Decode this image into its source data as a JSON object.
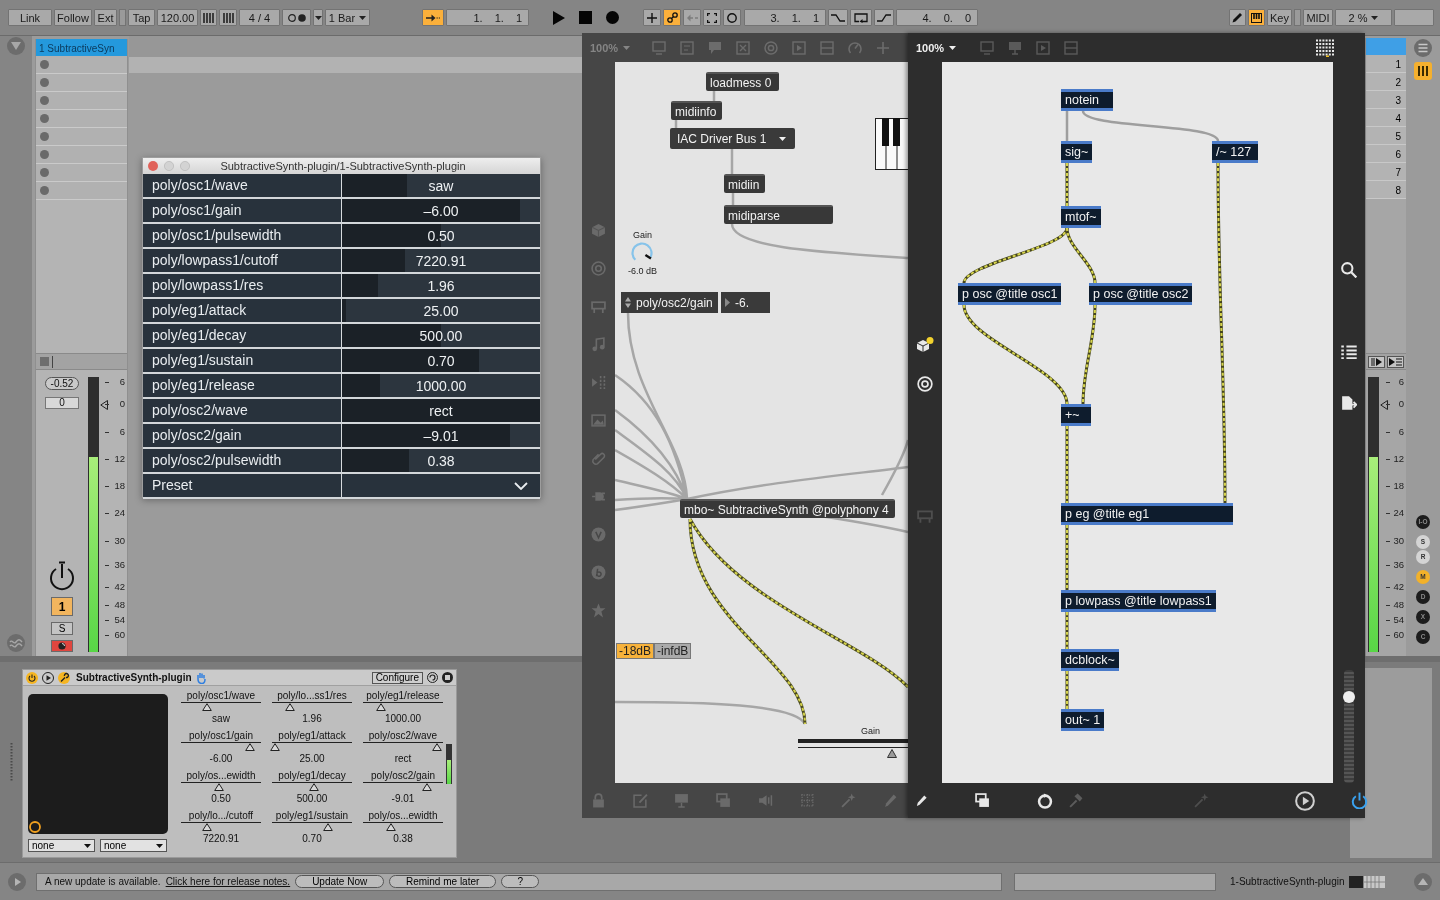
{
  "transport_bar": {
    "link": "Link",
    "follow": "Follow",
    "ext": "Ext",
    "tap": "Tap",
    "tempo": "120.00",
    "time_signature": "4 / 4",
    "metronome_on": false,
    "quantization": "1 Bar",
    "arrangement_follow_on": true,
    "song_position": "1. 1. 1",
    "arrangement_tools": [
      {
        "on": false,
        "disabled": false
      },
      {
        "on": true,
        "disabled": false
      },
      {
        "on": false,
        "disabled": true
      },
      {
        "on": false,
        "disabled": false
      },
      {
        "on": false,
        "disabled": false
      }
    ],
    "loop_start": "3. 1. 1",
    "punch_in_on": false,
    "loop_on": false,
    "punch_out_on": false,
    "loop_length": "4. 0. 0",
    "draw_mode_on": false,
    "keyboard_on": true,
    "key": "Key",
    "midi": "MIDI",
    "cpu_load": "2 %"
  },
  "track": {
    "name": "1 SubtractiveSyn",
    "peak": "-0.52",
    "volume": "0",
    "meter": {
      "level": 0.71
    },
    "fader": {
      "level": 0.9
    },
    "scale": [
      "6",
      "0",
      "6",
      "12",
      "18",
      "24",
      "30",
      "36",
      "42",
      "48",
      "54",
      "60"
    ],
    "number": "1",
    "active": true,
    "solo": "S",
    "solo_on": false,
    "armed": true
  },
  "scenes": [
    "1",
    "2",
    "3",
    "4",
    "5",
    "6",
    "7",
    "8"
  ],
  "master": {
    "view_toggle_on": true,
    "meter": {
      "level": 0.71
    },
    "fader": {
      "level": 0.9
    },
    "scale": [
      "6",
      "0",
      "6",
      "12",
      "18",
      "24",
      "30",
      "36",
      "42",
      "48",
      "54",
      "60"
    ],
    "section_toggles": [
      {
        "label": "I-O",
        "color": "#1c1c1c"
      },
      {
        "label": "S",
        "color": "#d4d4d4"
      },
      {
        "label": "R",
        "color": "#d4d4d4"
      },
      {
        "label": "M",
        "color": "#f2b12a"
      },
      {
        "label": "D",
        "color": "#1c1c1c"
      },
      {
        "label": "X",
        "color": "#1c1c1c"
      },
      {
        "label": "C",
        "color": "#1c1c1c"
      }
    ]
  },
  "device": {
    "on": true,
    "name": "SubtractiveSynth-plugin",
    "configure": "Configure",
    "parameters": [
      {
        "label": "poly/osc1/wave",
        "value": "saw",
        "level": 0.32
      },
      {
        "label": "poly/osc1/gain",
        "value": "-6.00",
        "level": 0.86
      },
      {
        "label": "poly/os...ewidth",
        "value": "0.50",
        "level": 0.48
      },
      {
        "label": "poly/lo.../cutoff",
        "value": "7220.91",
        "level": 0.32
      },
      {
        "label": "poly/lo...ss1/res",
        "value": "1.96",
        "level": 0.23
      },
      {
        "label": "poly/eg1/attack",
        "value": "25.00",
        "level": 0.04
      },
      {
        "label": "poly/eg1/decay",
        "value": "500.00",
        "level": 0.52
      },
      {
        "label": "poly/eg1/sustain",
        "value": "0.70",
        "level": 0.7
      },
      {
        "label": "poly/eg1/release",
        "value": "1000.00",
        "level": 0.23
      },
      {
        "label": "poly/osc2/wave",
        "value": "rect",
        "level": 0.93
      },
      {
        "label": "poly/osc2/gain",
        "value": "-9.01",
        "level": 0.8
      },
      {
        "label": "poly/os...ewidth",
        "value": "0.38",
        "level": 0.35
      }
    ],
    "dropdowns": [
      "none",
      "none"
    ],
    "meter": {
      "level": 0.6
    }
  },
  "parameter_window": {
    "title": "SubtractiveSynth-plugin/1-SubtractiveSynth-plugin",
    "rows": [
      {
        "label": "poly/osc1/wave",
        "value": "saw",
        "level": 0.33
      },
      {
        "label": "poly/osc1/gain",
        "value": "–6.00",
        "level": 0.9
      },
      {
        "label": "poly/osc1/pulsewidth",
        "value": "0.50",
        "level": 0.5
      },
      {
        "label": "poly/lowpass1/cutoff",
        "value": "7220.91",
        "level": 0.32
      },
      {
        "label": "poly/lowpass1/res",
        "value": "1.96",
        "level": 0.18
      },
      {
        "label": "poly/eg1/attack",
        "value": "25.00",
        "level": 0.02
      },
      {
        "label": "poly/eg1/decay",
        "value": "500.00",
        "level": 0.5
      },
      {
        "label": "poly/eg1/sustain",
        "value": "0.70",
        "level": 0.69
      },
      {
        "label": "poly/eg1/release",
        "value": "1000.00",
        "level": 0.19
      },
      {
        "label": "poly/osc2/wave",
        "value": "rect",
        "level": 1.0
      },
      {
        "label": "poly/osc2/gain",
        "value": "–9.01",
        "level": 0.85
      },
      {
        "label": "poly/osc2/pulsewidth",
        "value": "0.38",
        "level": 0.34
      }
    ],
    "preset": "Preset"
  },
  "patcher_back": {
    "zoom": "100%",
    "objects": [
      {
        "kind": "object",
        "text": "loadmess 0"
      },
      {
        "kind": "object",
        "text": "midiinfo"
      },
      {
        "kind": "menu",
        "text": "IAC Driver Bus 1"
      },
      {
        "kind": "object",
        "text": "midiin"
      },
      {
        "kind": "object",
        "text": "midiparse"
      },
      {
        "kind": "keyboard"
      },
      {
        "kind": "dial",
        "label": "Gain",
        "value": "-6.0 dB",
        "level": 0.95
      },
      {
        "kind": "parameter",
        "text": "poly/osc2/gain"
      },
      {
        "kind": "number",
        "text": "-6."
      },
      {
        "kind": "object",
        "text": "mbo~ SubtractiveSynth @polyphony 4"
      },
      {
        "kind": "slider",
        "label": "Gain",
        "level": 0.85
      }
    ],
    "level_buttons": [
      {
        "text": "-18dB",
        "selected": true
      },
      {
        "text": "-infdB",
        "selected": false
      }
    ]
  },
  "patcher_front": {
    "zoom": "100%",
    "objects": [
      "notein",
      "sig~",
      "/~ 127",
      "mtof~",
      "p osc @title osc1",
      "p osc @title osc2",
      "+~",
      "p eg @title eg1",
      "p lowpass @title lowpass1",
      "dcblock~",
      "out~ 1"
    ],
    "fader": {
      "level": 0.76
    }
  },
  "status_bar": {
    "message": "A new update is available.",
    "link": "Click here for release notes.",
    "buttons": [
      "Update Now",
      "Remind me later",
      "?"
    ],
    "device_name": "1-SubtractiveSynth-plugin"
  }
}
